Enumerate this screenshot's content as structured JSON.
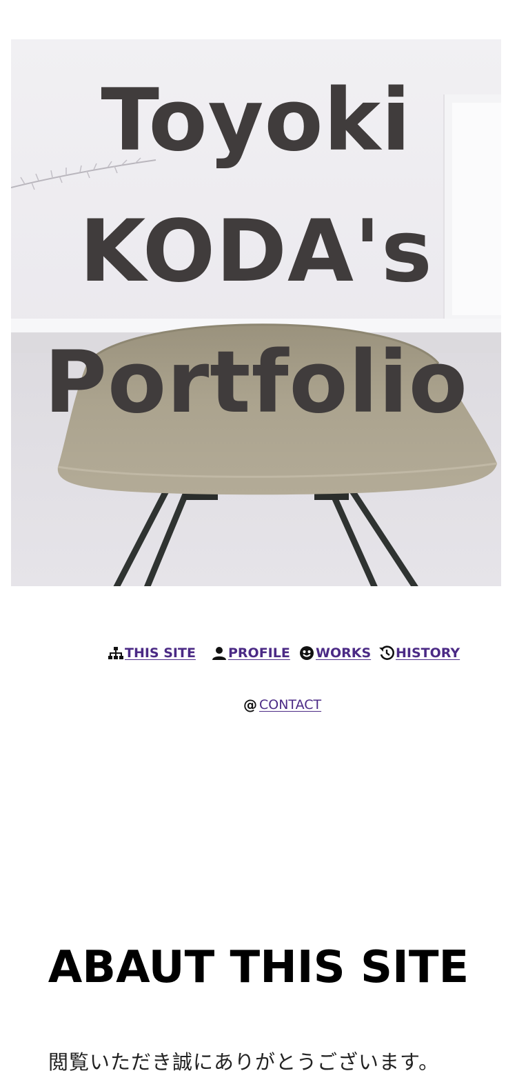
{
  "hero": {
    "title_lines": [
      "Toyoki",
      "KODA's",
      "Portfolio"
    ],
    "image": "chair-photo"
  },
  "nav": {
    "items": [
      {
        "icon": "sitemap-icon",
        "label": "THIS SITE"
      },
      {
        "icon": "user-icon",
        "label": "PROFILE"
      },
      {
        "icon": "smile-icon",
        "label": "WORKS"
      },
      {
        "icon": "history-icon",
        "label": "HISTORY"
      },
      {
        "icon": "at-sign-icon",
        "label": "CONTACT"
      }
    ]
  },
  "about": {
    "title": "ABAUT THIS SITE",
    "text": "閲覧いただき誠にありがとうございます。"
  },
  "colors": {
    "title_text": "#403c3c",
    "link": "#4b2a85",
    "background": "#ffffff",
    "chair": "#a59d88"
  }
}
